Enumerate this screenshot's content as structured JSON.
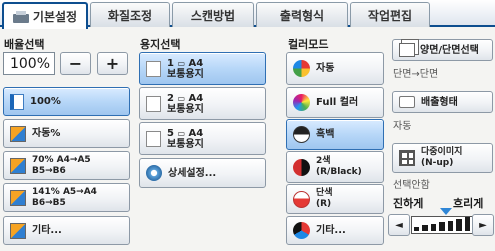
{
  "tabs": [
    {
      "label": "기본설정",
      "active": true
    },
    {
      "label": "화질조정",
      "active": false
    },
    {
      "label": "스캔방법",
      "active": false
    },
    {
      "label": "출력형식",
      "active": false
    },
    {
      "label": "작업편집",
      "active": false
    }
  ],
  "reduce_enlarge": {
    "heading": "배율선택",
    "percent_value": "100%",
    "minus_label": "−",
    "plus_label": "+",
    "options": [
      "100%",
      "자동%",
      "70% A4→A5\nB5→B6",
      "141% A5→A4\nB6→B5",
      "기타..."
    ]
  },
  "paper_supply": {
    "heading": "용지선택",
    "options": [
      {
        "tray": "1",
        "size": "A4",
        "type": "보통용지"
      },
      {
        "tray": "2",
        "size": "A4",
        "type": "보통용지"
      },
      {
        "tray": "5",
        "size": "A4",
        "type": "보통용지"
      }
    ],
    "more_label": "상세설정..."
  },
  "color_mode": {
    "heading": "컬러모드",
    "options": [
      "자동",
      "Full 컬러",
      "흑백",
      "2색\n(R/Black)",
      "단색\n(R)",
      "기타..."
    ]
  },
  "duplex": {
    "label": "양면/단면선택",
    "value": "단면→단면"
  },
  "output": {
    "label": "배출형태",
    "value": "자동"
  },
  "multi_up": {
    "label": "다중이미지\n(N-up)",
    "value": "선택안함"
  },
  "density": {
    "lighter_label": "진하게",
    "darker_label": "흐리게",
    "left_arrow": "◄",
    "right_arrow": "►",
    "level": 3,
    "levels": 7
  }
}
